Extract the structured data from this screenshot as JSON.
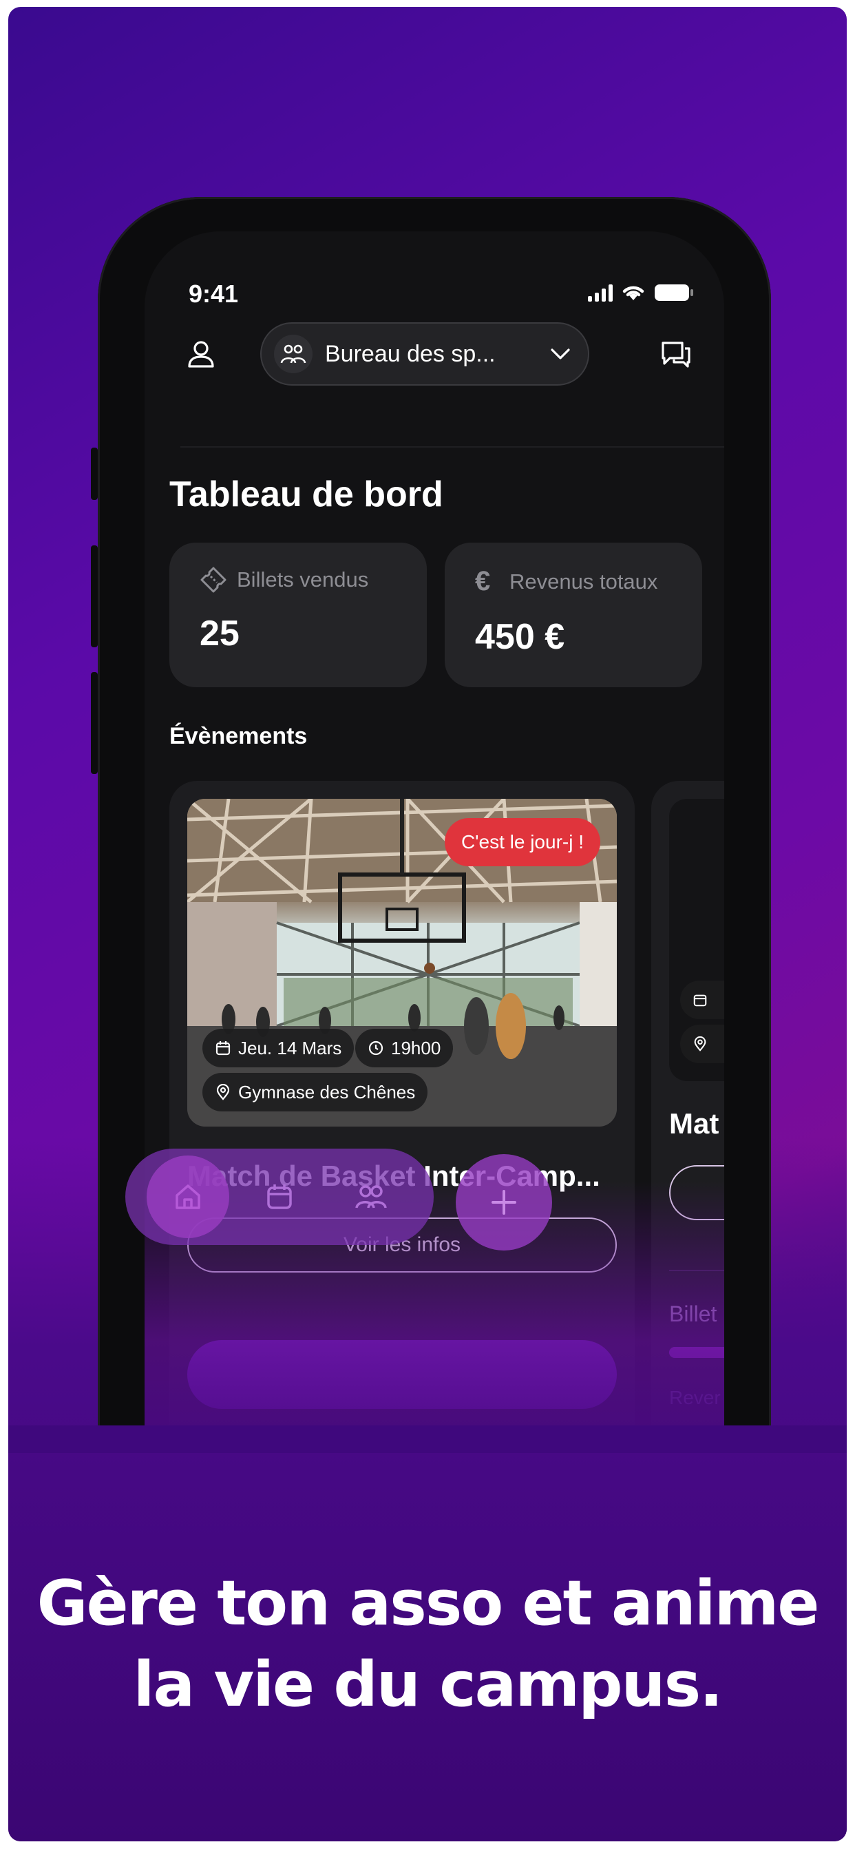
{
  "status_bar": {
    "time": "9:41"
  },
  "header": {
    "association_name": "Bureau des sp...",
    "icons": [
      "profile-icon",
      "group-icon",
      "chevron-down-icon",
      "chat-icon"
    ]
  },
  "dashboard": {
    "title": "Tableau de bord",
    "stats": [
      {
        "label": "Billets vendus",
        "value": "25",
        "icon": "ticket-icon"
      },
      {
        "label": "Revenus totaux",
        "value": "450 €",
        "icon": "euro-icon"
      }
    ]
  },
  "events_section": {
    "title": "Évènements",
    "featured": {
      "badge": "C'est le jour-j !",
      "date": "Jeu. 14 Mars",
      "time": "19h00",
      "location": "Gymnase des Chênes",
      "title": "Match de Basket Inter-Camp...",
      "info_button": "Voir les infos"
    },
    "peek": {
      "title": "Mat",
      "tickets_label": "Billet",
      "revenue_label": "Rever"
    }
  },
  "tab_bar": {
    "tabs": [
      "home-icon",
      "calendar-icon",
      "group-icon"
    ],
    "fab_icon": "plus-icon"
  },
  "marketing": {
    "headline_line1": "Gère ton asso et anime",
    "headline_line2": "la vie du campus."
  },
  "colors": {
    "background_purple": "#6c0aa6",
    "badge_red": "#e0343c",
    "accent_purple": "#7c2fc6"
  }
}
